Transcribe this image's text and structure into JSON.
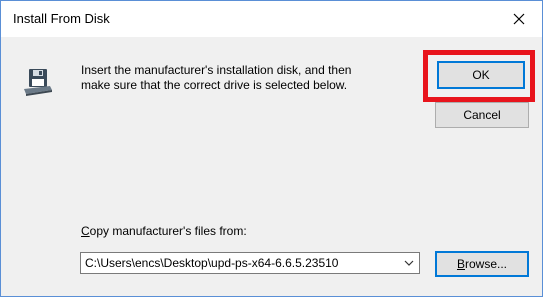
{
  "window": {
    "title": "Install From Disk",
    "close_icon": "close-icon"
  },
  "icon": "floppy-disk-icon",
  "message": {
    "line1": "Insert the manufacturer's installation disk, and then",
    "line2": "make sure that the correct drive is selected below."
  },
  "buttons": {
    "ok_label": "OK",
    "cancel_label": "Cancel",
    "browse_label_mnemonic": "B",
    "browse_label_rest": "rowse..."
  },
  "copy_from": {
    "label_mnemonic": "C",
    "label_rest": "opy manufacturer's files from:",
    "value": "C:\\Users\\encs\\Desktop\\upd-ps-x64-6.6.5.23510"
  },
  "colors": {
    "highlight": "#e8141c",
    "focus_border": "#0078d7"
  }
}
